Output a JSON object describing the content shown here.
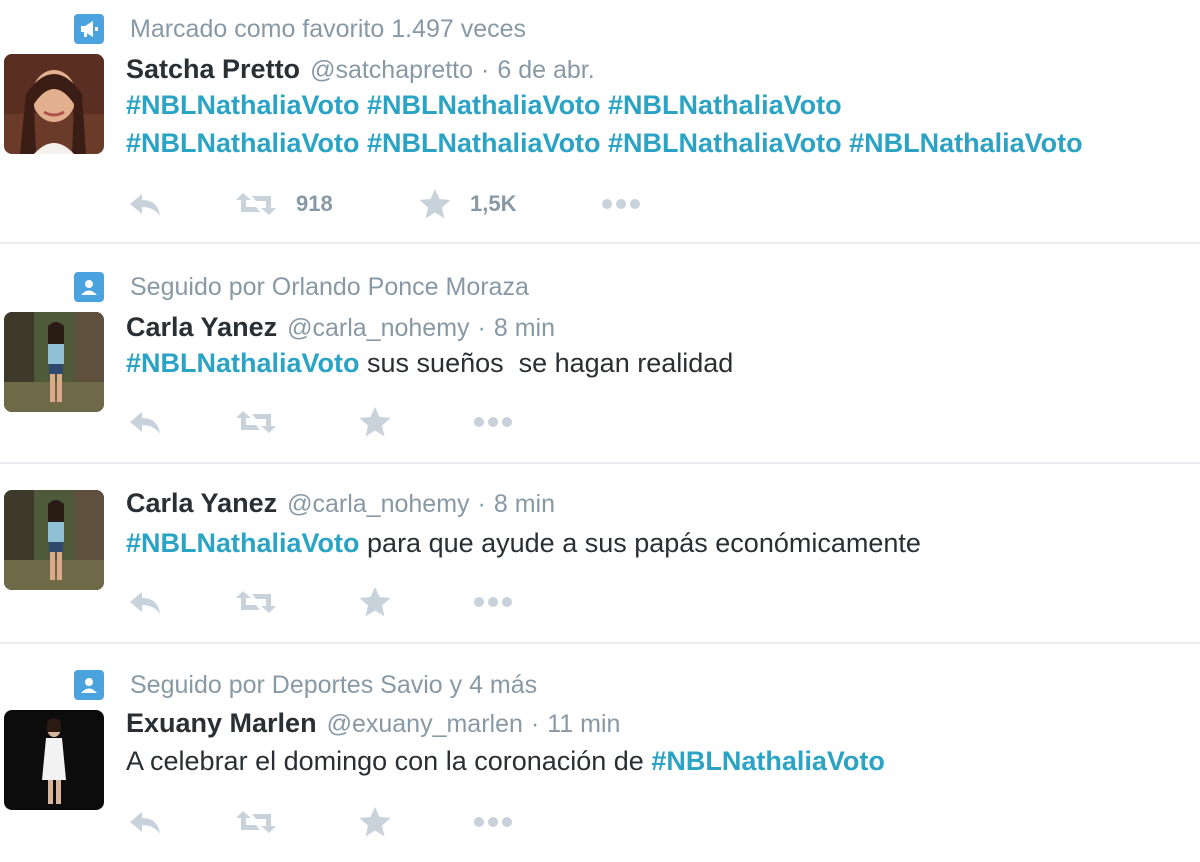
{
  "colors": {
    "hashtag": "#2ba3c4",
    "muted": "#8899a6",
    "context_icon": "#4aa3df",
    "divider": "#e6ecf0"
  },
  "tweets": [
    {
      "context": {
        "icon": "megaphone-icon",
        "text": "Marcado como favorito 1.497 veces"
      },
      "fullname": "Satcha Pretto",
      "handle": "@satchapretto",
      "separator": "·",
      "time": "6 de abr.",
      "lines": [
        "#NBLNathaliaVoto #NBLNathaliaVoto #NBLNathaliaVoto",
        "#NBLNathaliaVoto #NBLNathaliaVoto #NBLNathaliaVoto #NBLNathaliaVoto"
      ],
      "retweets": "918",
      "favorites": "1,5K"
    },
    {
      "context": {
        "icon": "person-icon",
        "text": "Seguido por Orlando Ponce Moraza"
      },
      "fullname": "Carla Yanez",
      "handle": "@carla_nohemy",
      "separator": "·",
      "time": "8 min",
      "hashtag": "#NBLNathaliaVoto",
      "text": " sus sueños  se hagan realidad"
    },
    {
      "fullname": "Carla Yanez",
      "handle": "@carla_nohemy",
      "separator": "·",
      "time": "8 min",
      "hashtag": "#NBLNathaliaVoto",
      "text": " para que ayude a sus papás económicamente"
    },
    {
      "context": {
        "icon": "person-icon",
        "text": "Seguido por Deportes Savio y 4 más"
      },
      "fullname": "Exuany Marlen",
      "handle": "@exuany_marlen",
      "separator": "·",
      "time": "11 min",
      "text": "A celebrar el domingo con la coronación de ",
      "hashtag": "#NBLNathaliaVoto"
    }
  ]
}
